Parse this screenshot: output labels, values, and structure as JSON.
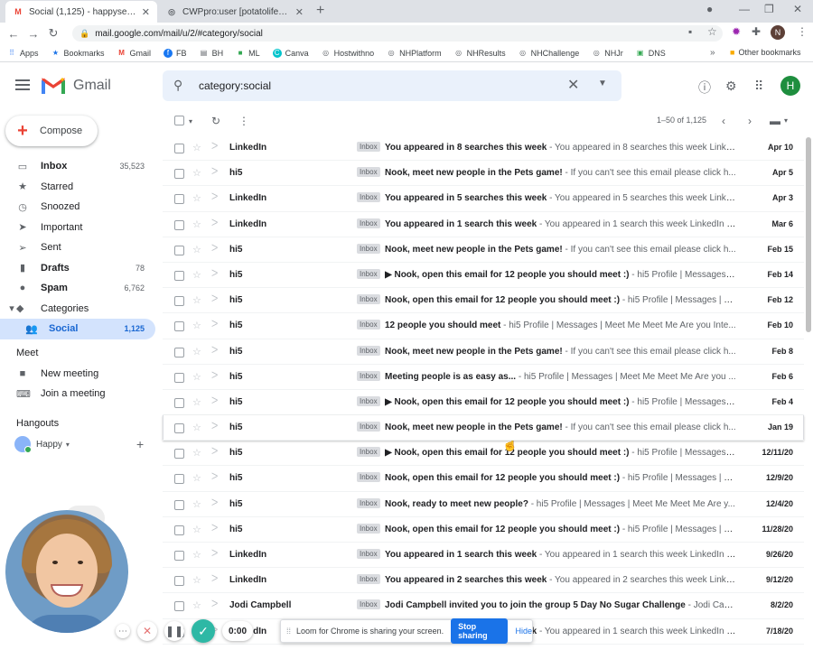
{
  "browser": {
    "tabs": [
      {
        "title": "Social (1,125) - happysellers09@",
        "active": true
      },
      {
        "title": "CWPpro:user [potatolifenow]",
        "active": false
      }
    ],
    "url": "mail.google.com/mail/u/2/#category/social",
    "profile_initial": "N",
    "bookmarks": [
      "Apps",
      "Bookmarks",
      "Gmail",
      "FB",
      "BH",
      "ML",
      "Canva",
      "Hostwithno",
      "NHPlatform",
      "NHResults",
      "NHChallenge",
      "NHJr",
      "DNS"
    ],
    "other_bookmarks": "Other bookmarks"
  },
  "header": {
    "wordmark": "Gmail",
    "search_value": "category:social",
    "avatar_initial": "H"
  },
  "sidebar": {
    "compose_label": "Compose",
    "items": [
      {
        "label": "Inbox",
        "count": "35,523",
        "icon": "inbox-icon"
      },
      {
        "label": "Starred",
        "count": "",
        "icon": "star-icon"
      },
      {
        "label": "Snoozed",
        "count": "",
        "icon": "clock-icon"
      },
      {
        "label": "Important",
        "count": "",
        "icon": "important-icon"
      },
      {
        "label": "Sent",
        "count": "",
        "icon": "send-icon"
      },
      {
        "label": "Drafts",
        "count": "78",
        "icon": "draft-icon"
      },
      {
        "label": "Spam",
        "count": "6,762",
        "icon": "spam-icon"
      },
      {
        "label": "Categories",
        "count": "",
        "icon": "label-icon"
      },
      {
        "label": "Social",
        "count": "1,125",
        "icon": "people-icon"
      }
    ],
    "meet_title": "Meet",
    "meet_items": [
      "New meeting",
      "Join a meeting"
    ],
    "hangouts_title": "Hangouts",
    "hangouts_user": "Happy"
  },
  "mail_toolbar": {
    "pager": "1–50 of 1,125"
  },
  "emails": [
    {
      "sender": "LinkedIn",
      "badge": "Inbox",
      "subject": "You appeared in 8 searches this week",
      "snippet": " - You appeared in 8 searches this week Linke...",
      "date": "Apr 10"
    },
    {
      "sender": "hi5",
      "badge": "Inbox",
      "subject": "Nook, meet new people in the Pets game!",
      "snippet": " - If you can't see this email please click h...",
      "date": "Apr 5"
    },
    {
      "sender": "LinkedIn",
      "badge": "Inbox",
      "subject": "You appeared in 5 searches this week",
      "snippet": " - You appeared in 5 searches this week Linke...",
      "date": "Apr 3"
    },
    {
      "sender": "LinkedIn",
      "badge": "Inbox",
      "subject": "You appeared in 1 search this week",
      "snippet": " - You appeared in 1 search this week LinkedIn N...",
      "date": "Mar 6"
    },
    {
      "sender": "hi5",
      "badge": "Inbox",
      "subject": "Nook, meet new people in the Pets game!",
      "snippet": " - If you can't see this email please click h...",
      "date": "Feb 15"
    },
    {
      "sender": "hi5",
      "badge": "Inbox",
      "subject": "▶ Nook, open this email for 12 people you should meet :)",
      "snippet": " - hi5 Profile | Messages | ...",
      "date": "Feb 14"
    },
    {
      "sender": "hi5",
      "badge": "Inbox",
      "subject": "Nook, open this email for 12 people you should meet :)",
      "snippet": " - hi5 Profile | Messages | M...",
      "date": "Feb 12"
    },
    {
      "sender": "hi5",
      "badge": "Inbox",
      "subject": "12 people you should meet",
      "snippet": " - hi5 Profile | Messages | Meet Me Meet Me Are you Inte...",
      "date": "Feb 10"
    },
    {
      "sender": "hi5",
      "badge": "Inbox",
      "subject": "Nook, meet new people in the Pets game!",
      "snippet": " - If you can't see this email please click h...",
      "date": "Feb 8"
    },
    {
      "sender": "hi5",
      "badge": "Inbox",
      "subject": "Meeting people is as easy as...",
      "snippet": " - hi5 Profile | Messages | Meet Me Meet Me Are you ...",
      "date": "Feb 6"
    },
    {
      "sender": "hi5",
      "badge": "Inbox",
      "subject": "▶ Nook, open this email for 12 people you should meet :)",
      "snippet": " - hi5 Profile | Messages | ...",
      "date": "Feb 4"
    },
    {
      "sender": "hi5",
      "badge": "Inbox",
      "subject": "Nook, meet new people in the Pets game!",
      "snippet": " - If you can't see this email please click h...",
      "date": "Jan 19"
    },
    {
      "sender": "hi5",
      "badge": "Inbox",
      "subject": "▶ Nook, open this email for 12 people you should meet :)",
      "snippet": " - hi5 Profile | Messages | ...",
      "date": "12/11/20"
    },
    {
      "sender": "hi5",
      "badge": "Inbox",
      "subject": "Nook, open this email for 12 people you should meet :)",
      "snippet": " - hi5 Profile | Messages | M...",
      "date": "12/9/20"
    },
    {
      "sender": "hi5",
      "badge": "Inbox",
      "subject": "Nook, ready to meet new people?",
      "snippet": " - hi5 Profile | Messages | Meet Me Meet Me Are y...",
      "date": "12/4/20"
    },
    {
      "sender": "hi5",
      "badge": "Inbox",
      "subject": "Nook, open this email for 12 people you should meet :)",
      "snippet": " - hi5 Profile | Messages | M...",
      "date": "11/28/20"
    },
    {
      "sender": "LinkedIn",
      "badge": "Inbox",
      "subject": "You appeared in 1 search this week",
      "snippet": " - You appeared in 1 search this week LinkedIn N...",
      "date": "9/26/20"
    },
    {
      "sender": "LinkedIn",
      "badge": "Inbox",
      "subject": "You appeared in 2 searches this week",
      "snippet": " - You appeared in 2 searches this week Linke...",
      "date": "9/12/20"
    },
    {
      "sender": "Jodi Campbell",
      "badge": "Inbox",
      "subject": "Jodi Campbell invited you to join the group 5 Day No Sugar Challenge",
      "snippet": " - Jodi Campb...",
      "date": "8/2/20"
    },
    {
      "sender": "LinkedIn",
      "badge": "Inbox",
      "subject": "You appeared in 1 search this week",
      "snippet": " - You appeared in 1 search this week LinkedIn N...",
      "date": "7/18/20"
    }
  ],
  "loom": {
    "timer": "0:00",
    "share_text": "Loom for Chrome is sharing your screen.",
    "stop_label": "Stop sharing",
    "hide_label": "Hide"
  }
}
